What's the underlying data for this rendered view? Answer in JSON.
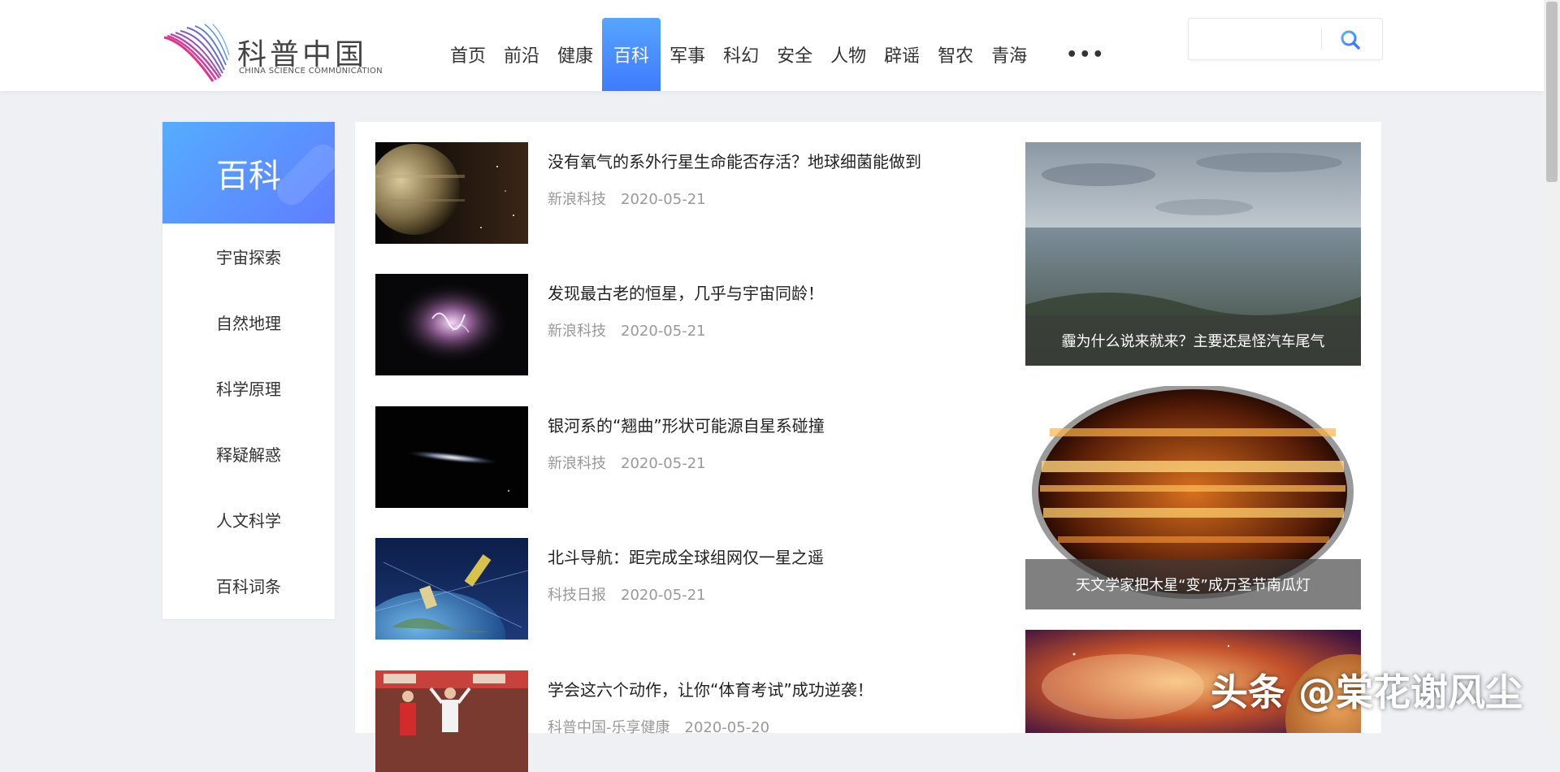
{
  "header": {
    "logo": {
      "cn": "科普中国",
      "en": "CHINA SCIENCE COMMUNICATION"
    },
    "nav": [
      {
        "label": "首页",
        "name": "nav-home"
      },
      {
        "label": "前沿",
        "name": "nav-frontier"
      },
      {
        "label": "健康",
        "name": "nav-health"
      },
      {
        "label": "百科",
        "name": "nav-encyclopedia",
        "active": true
      },
      {
        "label": "军事",
        "name": "nav-military"
      },
      {
        "label": "科幻",
        "name": "nav-scifi"
      },
      {
        "label": "安全",
        "name": "nav-safety"
      },
      {
        "label": "人物",
        "name": "nav-people"
      },
      {
        "label": "辟谣",
        "name": "nav-rumor"
      },
      {
        "label": "智农",
        "name": "nav-agriculture"
      },
      {
        "label": "青海",
        "name": "nav-qinghai"
      }
    ],
    "more_label": "•••",
    "search": {
      "value": "",
      "placeholder": ""
    }
  },
  "sidebar": {
    "title": "百科",
    "items": [
      {
        "label": "宇宙探索"
      },
      {
        "label": "自然地理"
      },
      {
        "label": "科学原理"
      },
      {
        "label": "释疑解惑"
      },
      {
        "label": "人文科学"
      },
      {
        "label": "百科词条"
      }
    ]
  },
  "articles": [
    {
      "title": "没有氧气的系外行星生命能否存活？地球细菌能做到",
      "source": "新浪科技",
      "date": "2020-05-21"
    },
    {
      "title": "发现最古老的恒星，几乎与宇宙同龄！",
      "source": "新浪科技",
      "date": "2020-05-21"
    },
    {
      "title": "银河系的“翘曲”形状可能源自星系碰撞",
      "source": "新浪科技",
      "date": "2020-05-21"
    },
    {
      "title": "北斗导航：距完成全球组网仅一星之遥",
      "source": "科技日报",
      "date": "2020-05-21"
    },
    {
      "title": "学会这六个动作，让你“体育考试”成功逆袭！",
      "source": "科普中国-乐享健康",
      "date": "2020-05-20"
    }
  ],
  "features": [
    {
      "caption": "霾为什么说来就来？主要还是怪汽车尾气"
    },
    {
      "caption": "天文学家把木星“变”成万圣节南瓜灯"
    },
    {
      "caption": ""
    }
  ],
  "watermark": "头条 @棠花谢风尘",
  "colors": {
    "accent": "#3e7bff",
    "accent_light": "#57a4ff",
    "background": "#eef0f4"
  }
}
